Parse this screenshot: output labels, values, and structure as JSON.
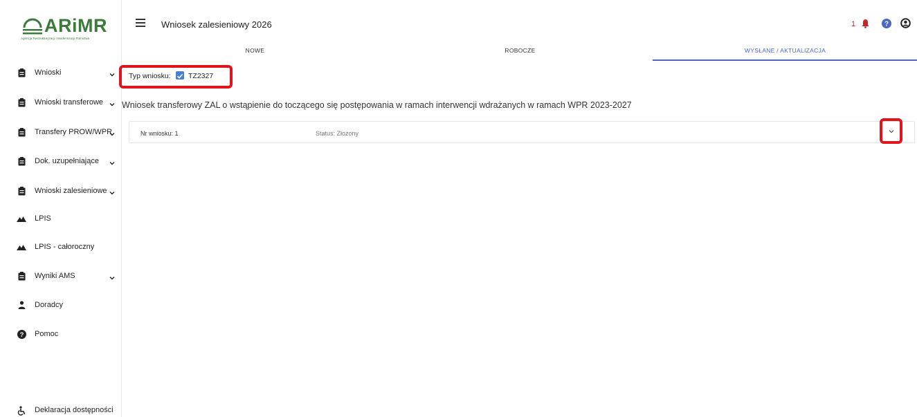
{
  "logo": {
    "name": "ARiMR",
    "subtitle": "Agencja Restrukturyzacji i Modernizacji Rolnictwa"
  },
  "header": {
    "title": "Wniosek zalesieniowy 2026",
    "notification_count": "1",
    "icons": [
      "menu-icon",
      "bell-icon",
      "help-icon",
      "user-icon"
    ]
  },
  "tabs": [
    {
      "label": "NOWE",
      "active": false
    },
    {
      "label": "ROBOCZE",
      "active": false
    },
    {
      "label": "WYSŁANE / AKTUALIZACJA",
      "active": true
    }
  ],
  "sidebar": {
    "items": [
      {
        "label": "Wnioski",
        "icon": "clipboard-icon",
        "expandable": true
      },
      {
        "label": "Wnioski transferowe",
        "icon": "clipboard-icon",
        "expandable": true
      },
      {
        "label": "Transfery PROW/WPR",
        "icon": "clipboard-icon",
        "expandable": true
      },
      {
        "label": "Dok. uzupełniające",
        "icon": "clipboard-icon",
        "expandable": true
      },
      {
        "label": "Wnioski zalesieniowe",
        "icon": "clipboard-icon",
        "expandable": true
      },
      {
        "label": "LPIS",
        "icon": "mountain-icon",
        "expandable": false
      },
      {
        "label": "LPIS - całoroczny",
        "icon": "mountain-icon",
        "expandable": false
      },
      {
        "label": "Wyniki AMS",
        "icon": "clipboard-icon",
        "expandable": true
      },
      {
        "label": "Doradcy",
        "icon": "person-icon",
        "expandable": false
      },
      {
        "label": "Pomoc",
        "icon": "help-icon",
        "expandable": false
      }
    ],
    "accessibility": "Deklaracja dostępności"
  },
  "filter": {
    "label": "Typ wniosku:",
    "checked": true,
    "value": "TZ2327"
  },
  "section": {
    "title": "Wniosek transferowy ZAL o wstąpienie do toczącego się postępowania w ramach interwencji wdrażanych w ramach WPR 2023-2027"
  },
  "application": {
    "number": "Nr wniosku: 1",
    "status": "Status: Złożony"
  },
  "colors": {
    "brand": "#3b7a3a",
    "accent": "#4a67c7",
    "highlight": "#e0141b",
    "notification": "#c62828"
  }
}
